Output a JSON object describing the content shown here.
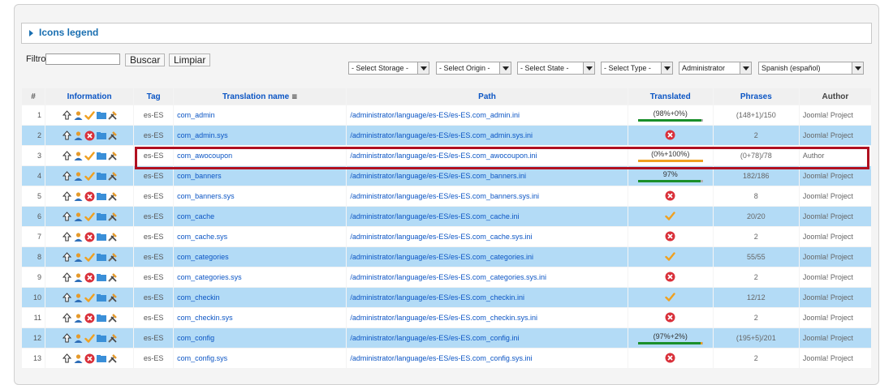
{
  "legend": {
    "label": "Icons legend"
  },
  "filter": {
    "label": "Filtro:",
    "value": "",
    "search_label": "Buscar",
    "clear_label": "Limpiar"
  },
  "selects": [
    {
      "value": "- Select Storage -"
    },
    {
      "value": "- Select Origin -"
    },
    {
      "value": "- Select State -"
    },
    {
      "value": "- Select Type -"
    },
    {
      "value": "Administrator"
    },
    {
      "value": "Spanish (español)"
    }
  ],
  "table": {
    "headers": {
      "num": "#",
      "information": "Information",
      "tag": "Tag",
      "name": "Translation name",
      "path": "Path",
      "translated": "Translated",
      "phrases": "Phrases",
      "author": "Author"
    },
    "rows": [
      {
        "num": "1",
        "tag": "es-ES",
        "name": "com_admin",
        "path": "/administrator/language/es-ES/es-ES.com_admin.ini",
        "translated": {
          "kind": "bar",
          "text": "(98%+0%)",
          "green": 98,
          "orange": 0
        },
        "phrases": "(148+1)/150",
        "author": "Joomla! Project",
        "state_icon": "check-icon"
      },
      {
        "num": "2",
        "tag": "es-ES",
        "name": "com_admin.sys",
        "path": "/administrator/language/es-ES/es-ES.com_admin.sys.ini",
        "translated": {
          "kind": "x"
        },
        "phrases": "2",
        "author": "Joomla! Project",
        "state_icon": "x-circle-icon"
      },
      {
        "num": "3",
        "tag": "es-ES",
        "name": "com_awocoupon",
        "path": "/administrator/language/es-ES/es-ES.com_awocoupon.ini",
        "translated": {
          "kind": "bar",
          "text": "(0%+100%)",
          "green": 0,
          "orange": 100
        },
        "phrases": "(0+78)/78",
        "author": "Author",
        "state_icon": "check-icon"
      },
      {
        "num": "4",
        "tag": "es-ES",
        "name": "com_banners",
        "path": "/administrator/language/es-ES/es-ES.com_banners.ini",
        "translated": {
          "kind": "bar",
          "text": "97%",
          "green": 97,
          "orange": 0
        },
        "phrases": "182/186",
        "author": "Joomla! Project",
        "state_icon": "check-icon"
      },
      {
        "num": "5",
        "tag": "es-ES",
        "name": "com_banners.sys",
        "path": "/administrator/language/es-ES/es-ES.com_banners.sys.ini",
        "translated": {
          "kind": "x"
        },
        "phrases": "8",
        "author": "Joomla! Project",
        "state_icon": "x-circle-icon"
      },
      {
        "num": "6",
        "tag": "es-ES",
        "name": "com_cache",
        "path": "/administrator/language/es-ES/es-ES.com_cache.ini",
        "translated": {
          "kind": "check"
        },
        "phrases": "20/20",
        "author": "Joomla! Project",
        "state_icon": "check-icon"
      },
      {
        "num": "7",
        "tag": "es-ES",
        "name": "com_cache.sys",
        "path": "/administrator/language/es-ES/es-ES.com_cache.sys.ini",
        "translated": {
          "kind": "x"
        },
        "phrases": "2",
        "author": "Joomla! Project",
        "state_icon": "x-circle-icon"
      },
      {
        "num": "8",
        "tag": "es-ES",
        "name": "com_categories",
        "path": "/administrator/language/es-ES/es-ES.com_categories.ini",
        "translated": {
          "kind": "check"
        },
        "phrases": "55/55",
        "author": "Joomla! Project",
        "state_icon": "check-icon"
      },
      {
        "num": "9",
        "tag": "es-ES",
        "name": "com_categories.sys",
        "path": "/administrator/language/es-ES/es-ES.com_categories.sys.ini",
        "translated": {
          "kind": "x"
        },
        "phrases": "2",
        "author": "Joomla! Project",
        "state_icon": "x-circle-icon"
      },
      {
        "num": "10",
        "tag": "es-ES",
        "name": "com_checkin",
        "path": "/administrator/language/es-ES/es-ES.com_checkin.ini",
        "translated": {
          "kind": "check"
        },
        "phrases": "12/12",
        "author": "Joomla! Project",
        "state_icon": "check-icon"
      },
      {
        "num": "11",
        "tag": "es-ES",
        "name": "com_checkin.sys",
        "path": "/administrator/language/es-ES/es-ES.com_checkin.sys.ini",
        "translated": {
          "kind": "x"
        },
        "phrases": "2",
        "author": "Joomla! Project",
        "state_icon": "x-circle-icon"
      },
      {
        "num": "12",
        "tag": "es-ES",
        "name": "com_config",
        "path": "/administrator/language/es-ES/es-ES.com_config.ini",
        "translated": {
          "kind": "bar",
          "text": "(97%+2%)",
          "green": 97,
          "orange": 2
        },
        "phrases": "(195+5)/201",
        "author": "Joomla! Project",
        "state_icon": "check-icon"
      },
      {
        "num": "13",
        "tag": "es-ES",
        "name": "com_config.sys",
        "path": "/administrator/language/es-ES/es-ES.com_config.sys.ini",
        "translated": {
          "kind": "x"
        },
        "phrases": "2",
        "author": "Joomla! Project",
        "state_icon": "x-circle-icon"
      }
    ]
  },
  "colors": {
    "link": "#0b55c4",
    "row_alt": "#b3dbf6",
    "bar_green": "#1a8f2a",
    "bar_orange": "#f0a020",
    "error_red": "#d9303a",
    "highlight": "#b01020"
  }
}
